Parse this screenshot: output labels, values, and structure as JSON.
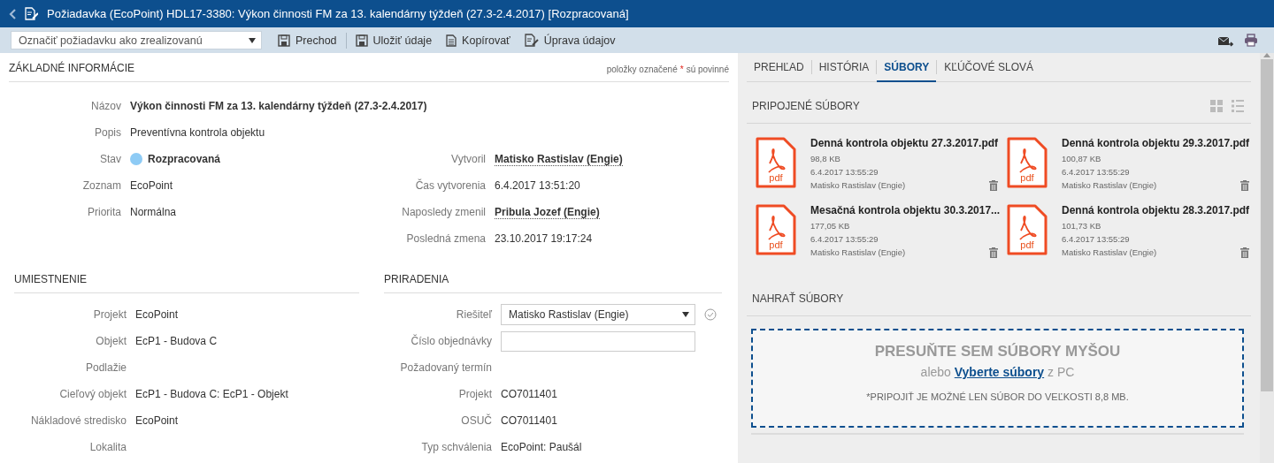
{
  "window": {
    "title": "Požiadavka (EcoPoint) HDL17-3380: Výkon činnosti FM za 13. kalendárny týždeň (27.3-2.4.2017) [Rozpracovaná]"
  },
  "toolbar": {
    "action_select": "Označiť požiadavku ako zrealizovanú",
    "buttons": [
      {
        "label": "Prechod",
        "kind": "save",
        "separator_after": true
      },
      {
        "label": "Uložiť údaje",
        "kind": "save",
        "separator_after": false
      },
      {
        "label": "Kopírovať",
        "kind": "copy",
        "separator_after": false
      },
      {
        "label": "Úprava údajov",
        "kind": "edit",
        "separator_after": false
      }
    ],
    "right_icons": [
      {
        "kind": "mail"
      },
      {
        "kind": "print"
      }
    ]
  },
  "basic_info": {
    "title": "ZÁKLADNÉ INFORMÁCIE",
    "required_note": [
      "položky označené",
      "*",
      "sú povinné"
    ],
    "wide_fields": [
      {
        "label": "Názov",
        "value": "Výkon činnosti FM za 13. kalendárny týždeň (27.3-2.4.2017)",
        "kind": "bold"
      },
      {
        "label": "Popis",
        "value": "Preventívna kontrola objektu",
        "kind": "text"
      }
    ],
    "left_fields": [
      {
        "label": "Stav",
        "value": "Rozpracovaná",
        "kind": "status",
        "color": "#8ecbf5"
      },
      {
        "label": "Zoznam",
        "value": "EcoPoint",
        "kind": "text"
      },
      {
        "label": "Priorita",
        "value": "Normálna",
        "kind": "text"
      }
    ],
    "right_fields": [
      {
        "label": "Vytvoril",
        "value": "Matisko Rastislav (Engie)",
        "kind": "person"
      },
      {
        "label": "Čas vytvorenia",
        "value": "6.4.2017 13:51:20",
        "kind": "text"
      },
      {
        "label": "Naposledy zmenil",
        "value": "Pribula Jozef (Engie)",
        "kind": "person"
      },
      {
        "label": "Posledná zmena",
        "value": "23.10.2017 19:17:24",
        "kind": "text"
      }
    ]
  },
  "location": {
    "title": "UMIESTNENIE",
    "fields": [
      {
        "label": "Projekt",
        "value": "EcoPoint",
        "kind": "text"
      },
      {
        "label": "Objekt",
        "value": "EcP1 - Budova C",
        "kind": "text"
      },
      {
        "label": "Podlažie",
        "kind": "empty"
      },
      {
        "label": "Cieľový objekt",
        "value": "EcP1 - Budova C: EcP1 - Objekt",
        "kind": "text"
      },
      {
        "label": "Nákladové stredisko",
        "value": "EcoPoint",
        "kind": "text"
      },
      {
        "label": "Lokalita",
        "kind": "empty"
      }
    ]
  },
  "assignment": {
    "title": "PRIRADENIA",
    "fields": [
      {
        "label": "Riešiteľ",
        "value": "Matisko Rastislav (Engie)",
        "kind": "select"
      },
      {
        "label": "Číslo objednávky",
        "kind": "input"
      },
      {
        "label": "Požadovaný termín",
        "kind": "empty"
      },
      {
        "label": "Projekt",
        "value": "CO7011401",
        "kind": "text"
      },
      {
        "label": "OSUČ",
        "value": "CO7011401",
        "kind": "text"
      },
      {
        "label": "Typ schválenia",
        "value": "EcoPoint: Paušál",
        "kind": "text"
      }
    ]
  },
  "tabs": [
    {
      "label": "PREHĽAD",
      "selected": false
    },
    {
      "label": "HISTÓRIA",
      "selected": false
    },
    {
      "label": "SÚBORY",
      "selected": true
    },
    {
      "label": "KĽÚČOVÉ SLOVÁ",
      "selected": false
    }
  ],
  "attached": {
    "title": "PRIPOJENÉ SÚBORY",
    "files": [
      {
        "name": "Denná kontrola objektu 27.3.2017.pdf",
        "type": "pdf",
        "size": "98,8 KB",
        "date": "6.4.2017 13:55:29",
        "author": "Matisko Rastislav (Engie)"
      },
      {
        "name": "Denná kontrola objektu 29.3.2017.pdf",
        "type": "pdf",
        "size": "100,87 KB",
        "date": "6.4.2017 13:55:29",
        "author": "Matisko Rastislav (Engie)"
      },
      {
        "name": "Mesačná kontrola objektu 30.3.2017...",
        "type": "pdf",
        "size": "177,05 KB",
        "date": "6.4.2017 13:55:29",
        "author": "Matisko Rastislav (Engie)"
      },
      {
        "name": "Denná kontrola objektu 28.3.2017.pdf",
        "type": "pdf",
        "size": "101,73 KB",
        "date": "6.4.2017 13:55:29",
        "author": "Matisko Rastislav (Engie)"
      }
    ]
  },
  "upload": {
    "title": "NAHRAŤ SÚBORY",
    "drop_text": "PRESUŇTE SEM SÚBORY MYŠOU",
    "alt_prefix": "alebo",
    "alt_link": "Vyberte súbory",
    "alt_suffix": "z PC",
    "note": "*PRIPOJIŤ JE MOŽNÉ LEN SÚBOR DO VEĽKOSTI 8,8 MB."
  }
}
